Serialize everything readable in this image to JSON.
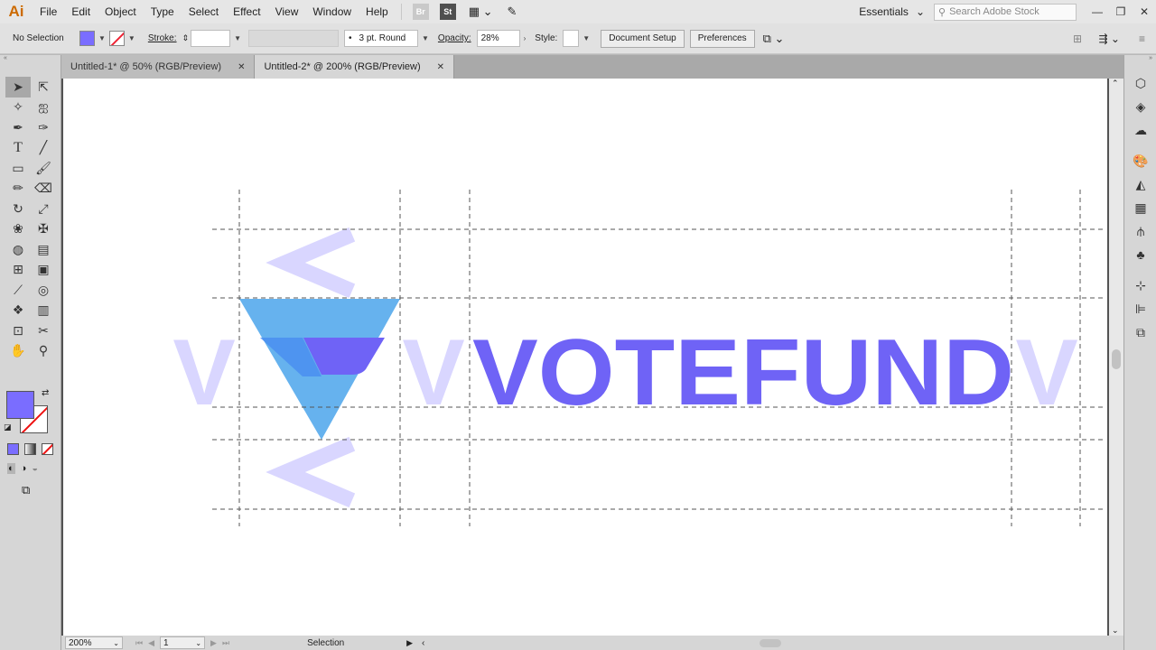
{
  "app": {
    "logo": "Ai",
    "bridge": "Br",
    "stock": "St"
  },
  "menu": [
    "File",
    "Edit",
    "Object",
    "Type",
    "Select",
    "Effect",
    "View",
    "Window",
    "Help"
  ],
  "workspace": "Essentials",
  "search": {
    "placeholder": "Search Adobe Stock"
  },
  "control": {
    "selection": "No Selection",
    "stroke_label": "Stroke:",
    "brush": "3 pt. Round",
    "opacity_label": "Opacity:",
    "opacity_value": "28%",
    "style_label": "Style:",
    "doc_setup": "Document Setup",
    "preferences": "Preferences"
  },
  "tabs": [
    {
      "label": "Untitled-1* @ 50% (RGB/Preview)",
      "active": false
    },
    {
      "label": "Untitled-2* @ 200% (RGB/Preview)",
      "active": true
    }
  ],
  "artwork": {
    "wordmark": "VOTEFUND",
    "ghost_letter": "V",
    "ghost_chevron": "<",
    "colors": {
      "primary": "#6f63f6",
      "ghost": "#d9d6ff",
      "blue_light": "#66b2ee",
      "blue_dark": "#4a8ef0",
      "guides": "#555555"
    }
  },
  "status": {
    "zoom": "200%",
    "artboard": "1",
    "tool": "Selection"
  },
  "colors": {
    "fill": "#7a6dff"
  }
}
